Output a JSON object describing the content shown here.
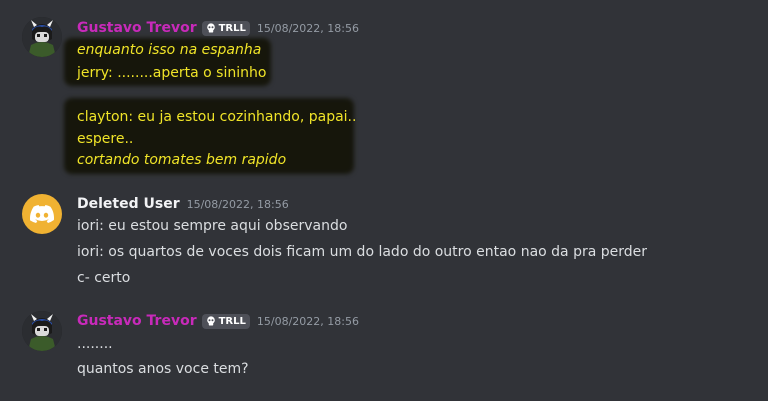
{
  "messages": [
    {
      "username": "Gustavo Trevor",
      "tag": "TRLL",
      "timestamp": "15/08/2022, 18:56",
      "avatar": "character-avatar",
      "lines": [
        "enquanto isso na espanha",
        "jerry: ........aperta o sininho",
        "clayton: eu ja estou cozinhando, papai..",
        "espere..",
        "cortando tomates bem rapido"
      ]
    },
    {
      "username": "Deleted User",
      "timestamp": "15/08/2022, 18:56",
      "avatar": "discord-logo-icon",
      "lines": [
        "iori: eu estou sempre aqui observando",
        "iori: os quartos de voces dois ficam um do lado do outro entao nao da pra perder",
        "c- certo"
      ]
    },
    {
      "username": "Gustavo Trevor",
      "tag": "TRLL",
      "timestamp": "15/08/2022, 18:56",
      "avatar": "character-avatar",
      "lines": [
        "........",
        "quantos anos voce tem?"
      ]
    }
  ],
  "colors": {
    "background": "#313338",
    "username_role": "#c82aba",
    "highlight_text": "#f0e428",
    "timestamp": "#949ba4",
    "discord_default_avatar": "#f0b232"
  }
}
